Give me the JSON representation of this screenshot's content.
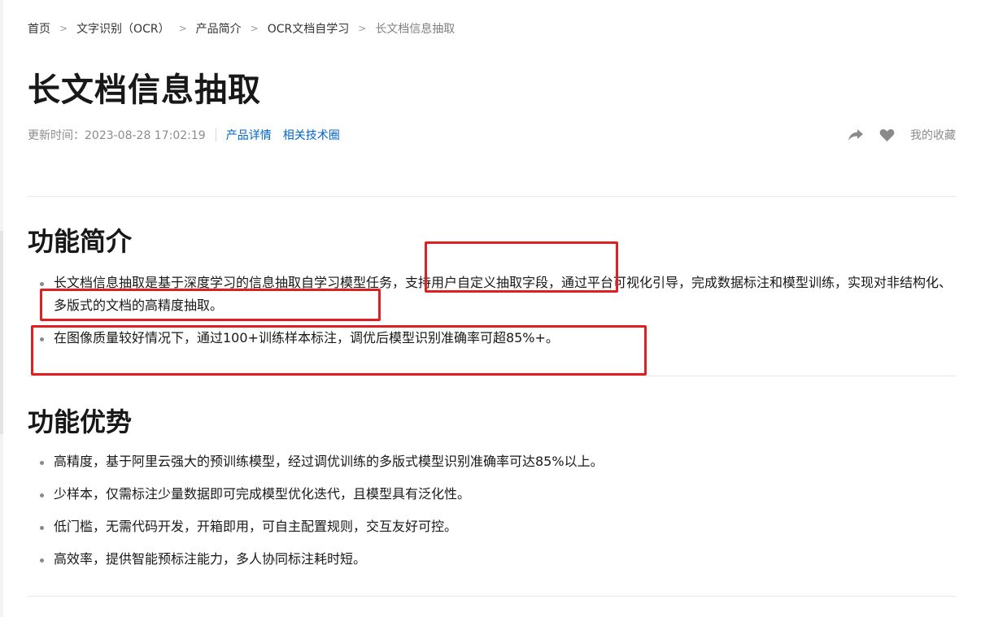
{
  "breadcrumb": {
    "items": [
      "首页",
      "文字识别（OCR）",
      "产品简介",
      "OCR文档自学习"
    ],
    "current": "长文档信息抽取"
  },
  "page": {
    "title": "长文档信息抽取",
    "update_time": "更新时间：2023-08-28 17:02:19",
    "product_detail_link": "产品详情",
    "related_tech_link": "相关技术圈",
    "favorites_label": "我的收藏"
  },
  "sections": {
    "intro": {
      "title": "功能简介",
      "items": [
        "长文档信息抽取是基于深度学习的信息抽取自学习模型任务，支持用户自定义抽取字段，通过平台可视化引导，完成数据标注和模型训练，实现对非结构化、多版式的文档的高精度抽取。",
        "在图像质量较好情况下，通过100+训练样本标注，调优后模型识别准确率可超85%+。"
      ]
    },
    "advantages": {
      "title": "功能优势",
      "items": [
        "高精度，基于阿里云强大的预训练模型，经过调优训练的多版式模型识别准确率可达85%以上。",
        "少样本，仅需标注少量数据即可完成模型优化迭代，且模型具有泛化性。",
        "低门槛，无需代码开发，开箱即用，可自主配置规则，交互友好可控。",
        "高效率，提供智能预标注能力，多人协同标注耗时短。"
      ]
    }
  },
  "icons": {
    "share": "share-icon",
    "favorite": "heart-icon",
    "breadcrumb_separator": "chevron-right-icon"
  },
  "colors": {
    "link": "#0064c8",
    "annotation_box": "#e02020",
    "muted_text": "#8c8c8c"
  }
}
